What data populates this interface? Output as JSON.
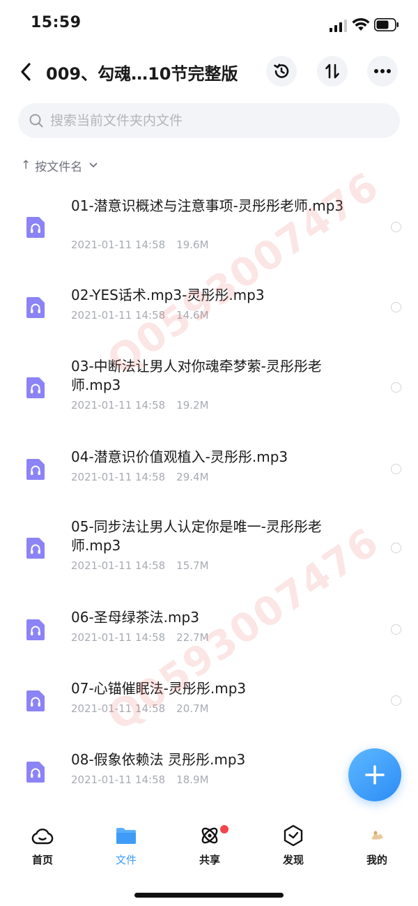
{
  "status_bar": {
    "time": "15:59"
  },
  "header": {
    "title": "009、勾魂…10节完整版"
  },
  "search": {
    "placeholder": "搜索当前文件夹内文件"
  },
  "sort": {
    "label": "按文件名"
  },
  "files": [
    {
      "name": "01-潜意识概述与注意事项-灵彤彤老师.mp3",
      "date": "2021-01-11 14:58",
      "size": "19.6M"
    },
    {
      "name": "02-YES话术.mp3-灵彤彤.mp3",
      "date": "2021-01-11 14:58",
      "size": "14.6M"
    },
    {
      "name": "03-中断法让男人对你魂牵梦萦-灵彤彤老师.mp3",
      "date": "2021-01-11 14:58",
      "size": "19.2M"
    },
    {
      "name": "04-潜意识价值观植入-灵彤彤.mp3",
      "date": "2021-01-11 14:58",
      "size": "29.4M"
    },
    {
      "name": "05-同步法让男人认定你是唯一-灵彤彤老师.mp3",
      "date": "2021-01-11 14:58",
      "size": "15.7M"
    },
    {
      "name": "06-圣母绿茶法.mp3",
      "date": "2021-01-11 14:58",
      "size": "22.7M"
    },
    {
      "name": "07-心锚催眠法-灵彤彤.mp3",
      "date": "2021-01-11 14:58",
      "size": "20.7M"
    },
    {
      "name": "08-假象依赖法 灵彤彤.mp3",
      "date": "2021-01-11 14:58",
      "size": "18.9M"
    }
  ],
  "watermark": "Q0593007476",
  "tabs": [
    {
      "label": "首页",
      "icon": "cloud-icon"
    },
    {
      "label": "文件",
      "icon": "folder-icon"
    },
    {
      "label": "共享",
      "icon": "atom-icon"
    },
    {
      "label": "发现",
      "icon": "compass-icon"
    },
    {
      "label": "我的",
      "icon": "avatar-icon"
    }
  ],
  "colors": {
    "accent": "#3e9cf8",
    "file_icon": "#8b83f6",
    "badge": "#f2464a"
  }
}
